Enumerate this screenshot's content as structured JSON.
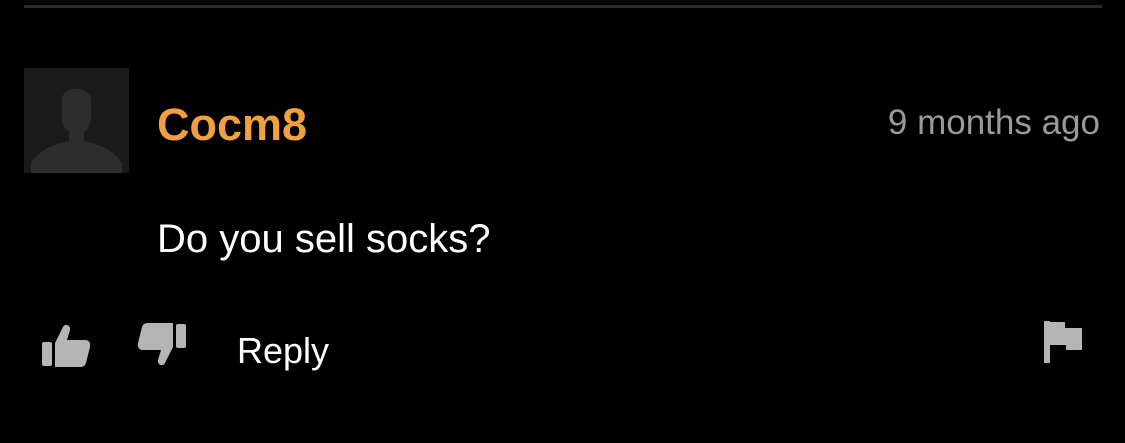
{
  "colors": {
    "background": "#000000",
    "divider": "#2a2a2a",
    "username": "#f29f3f",
    "timestamp": "#9a9a9a",
    "text": "#ffffff",
    "icon": "#b5b5b5",
    "avatar_bg": "#1b1b1b",
    "avatar_figure": "#2d2d2d"
  },
  "comment": {
    "avatar_icon": "default-user-silhouette",
    "username": "Cocm8",
    "timestamp": "9 months ago",
    "text": "Do you sell socks?"
  },
  "actions": {
    "like_icon": "thumbs-up",
    "dislike_icon": "thumbs-down",
    "reply_label": "Reply",
    "flag_icon": "flag"
  }
}
